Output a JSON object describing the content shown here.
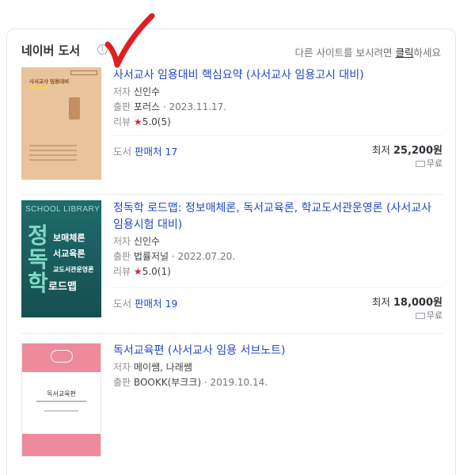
{
  "header": {
    "title": "네이버 도서",
    "info_icon": "i",
    "hint_prefix": "다른 사이트를 보시려면 ",
    "hint_link": "클릭",
    "hint_suffix": "하세요"
  },
  "books": [
    {
      "title": "사서교사 임용대비 핵심요약 (사서교사 임용고시 대비)",
      "author_label": "저자",
      "author": "신인수",
      "publisher_label": "출판",
      "publisher": "포러스",
      "date": "· 2023.11.17.",
      "review_label": "리뷰",
      "star": "★",
      "rating": "5.0",
      "review_count": "(5)",
      "stores_label": "도서",
      "stores_link": "판매처 17",
      "price_label": "최저",
      "price": "25,200원",
      "shipping": "무료"
    },
    {
      "title": "정독학 로드맵: 정보매체론, 독서교육론, 학교도서관운영론 (사서교사 임용시험 대비)",
      "author_label": "저자",
      "author": "신인수",
      "publisher_label": "출판",
      "publisher": "법률저널",
      "date": "· 2022.07.20.",
      "review_label": "리뷰",
      "star": "★",
      "rating": "5.0",
      "review_count": "(1)",
      "stores_label": "도서",
      "stores_link": "판매처 19",
      "price_label": "최저",
      "price": "18,000원",
      "shipping": "무료"
    },
    {
      "title": "독서교육편 (사서교사 임용 서브노트)",
      "author_label": "저자",
      "author": "메이쌤, 나래쌤",
      "publisher_label": "출판",
      "publisher": "BOOKK(부크크)",
      "date": "· 2019.10.14."
    }
  ],
  "covers": {
    "c1_line1": "사서교사 임용대비",
    "c1_line2": "핵심요약",
    "c2_school": "SCHOOL LIBRARY",
    "c2_big": "정\n독\n학",
    "c2_sub1": "보매체론",
    "c2_sub2": "서교육론",
    "c2_sub3": "교도서관운영론",
    "c2_road": "로드맵",
    "c3_title": "독서교육편"
  },
  "colors": {
    "link": "#2348c2",
    "star": "#e5202e",
    "checkmark": "#e02020"
  }
}
